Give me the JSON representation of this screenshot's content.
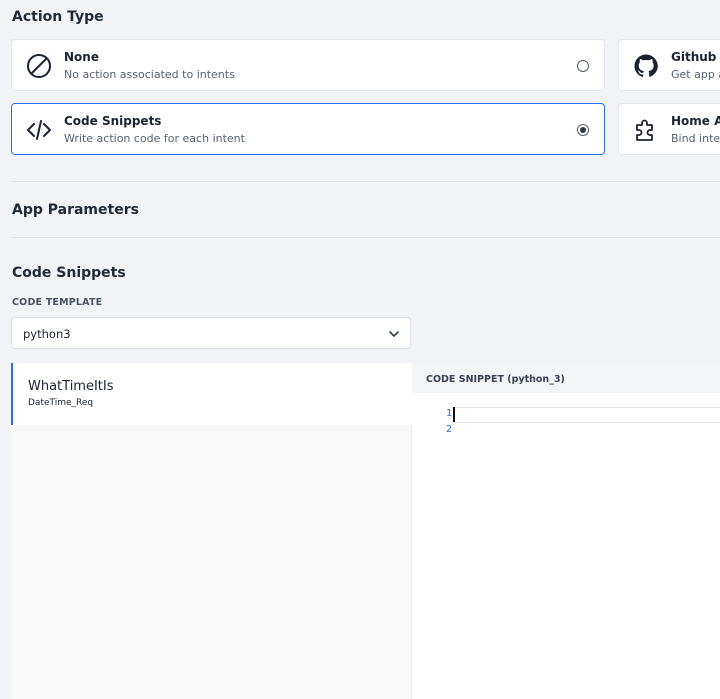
{
  "action_type": {
    "title": "Action Type",
    "cards": [
      {
        "id": "none",
        "title": "None",
        "desc": "No action associated to intents",
        "icon": "ban-icon",
        "selected": false
      },
      {
        "id": "code",
        "title": "Code Snippets",
        "desc": "Write action code for each intent",
        "icon": "code-icon",
        "selected": true
      },
      {
        "id": "github",
        "title": "Github",
        "desc": "Get app a",
        "icon": "github-icon",
        "selected": false
      },
      {
        "id": "home",
        "title": "Home As",
        "desc": "Bind inter",
        "icon": "puzzle-icon",
        "selected": false
      }
    ]
  },
  "app_parameters": {
    "title": "App Parameters"
  },
  "code_snippets": {
    "title": "Code Snippets",
    "template_label": "CODE TEMPLATE",
    "template_value": "python3",
    "intent": {
      "name": "WhatTimeItIs",
      "sub": "DateTime_Req"
    },
    "editor": {
      "label": "CODE SNIPPET (python_3)",
      "line_numbers": [
        "1",
        "2"
      ]
    }
  },
  "colors": {
    "accent": "#2d6ff0",
    "background": "#f2f3f6",
    "line_number": "#2f6bd6"
  }
}
